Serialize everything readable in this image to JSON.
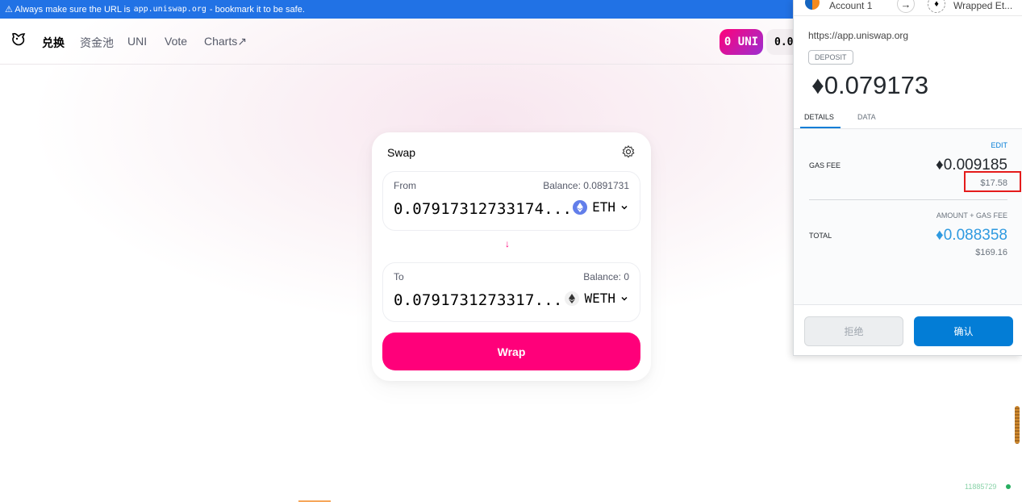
{
  "banner": {
    "prefix": "⚠ Always make sure the URL is",
    "url": "app.uniswap.org",
    "suffix": "- bookmark it to be safe."
  },
  "nav": {
    "swap": "兑换",
    "pool": "资金池",
    "uni": "UNI",
    "vote": "Vote",
    "charts": "Charts↗"
  },
  "header": {
    "uni_badge": "0 UNI",
    "eth_balance": "0.0"
  },
  "swap": {
    "title": "Swap",
    "from": {
      "label": "From",
      "balance": "Balance: 0.0891731",
      "amount": "0.07917312733174...",
      "token": "ETH"
    },
    "to": {
      "label": "To",
      "balance": "Balance: 0",
      "amount": "0.0791731273317...",
      "token": "WETH"
    },
    "arrow": "↓",
    "button": "Wrap"
  },
  "footer": {
    "block_number": "11885729"
  },
  "metamask": {
    "account": "Account 1",
    "token": "Wrapped Et...",
    "origin": "https://app.uniswap.org",
    "deposit": "DEPOSIT",
    "amount": "♦0.079173",
    "tabs": [
      "DETAILS",
      "DATA"
    ],
    "edit": "EDIT",
    "gas_fee_label": "GAS FEE",
    "gas_fee_eth": "♦0.009185",
    "gas_fee_usd": "$17.58",
    "amount_plus_gas": "AMOUNT + GAS FEE",
    "total_label": "TOTAL",
    "total_eth": "♦0.088358",
    "total_usd": "$169.16",
    "reject": "拒绝",
    "confirm": "确认"
  },
  "colors": {
    "uniswap_pink": "#ff007a",
    "banner_blue": "#2172e5",
    "metamask_blue": "#037dd6",
    "highlight_red": "#e41b1b"
  }
}
